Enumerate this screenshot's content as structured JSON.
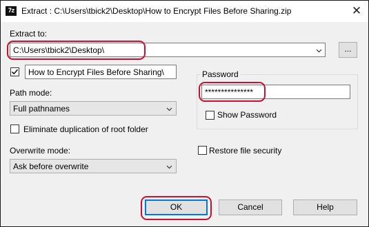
{
  "window": {
    "icon_text": "7z",
    "title": "Extract : C:\\Users\\tbick2\\Desktop\\How to Encrypt Files Before Sharing.zip",
    "close_symbol": "✕"
  },
  "extract_to": {
    "label": "Extract to:",
    "value": "C:\\Users\\tbick2\\Desktop\\",
    "browse_label": "..."
  },
  "subfolder": {
    "checked": true,
    "value": "How to Encrypt Files Before Sharing\\"
  },
  "path_mode": {
    "label": "Path mode:",
    "value": "Full pathnames"
  },
  "eliminate_duplication": {
    "label": "Eliminate duplication of root folder",
    "checked": false
  },
  "overwrite_mode": {
    "label": "Overwrite mode:",
    "value": "Ask before overwrite"
  },
  "password": {
    "group_label": "Password",
    "value": "***************",
    "show_label": "Show Password",
    "show_checked": false
  },
  "restore_security": {
    "label": "Restore file security",
    "checked": false
  },
  "buttons": {
    "ok": "OK",
    "cancel": "Cancel",
    "help": "Help"
  },
  "colors": {
    "highlight": "#c8102e",
    "default_button_border": "#0078d7"
  },
  "icons": {
    "app": "7zip-icon",
    "close": "close-icon",
    "dropdown": "chevron-down-icon",
    "check": "checkmark-icon"
  }
}
